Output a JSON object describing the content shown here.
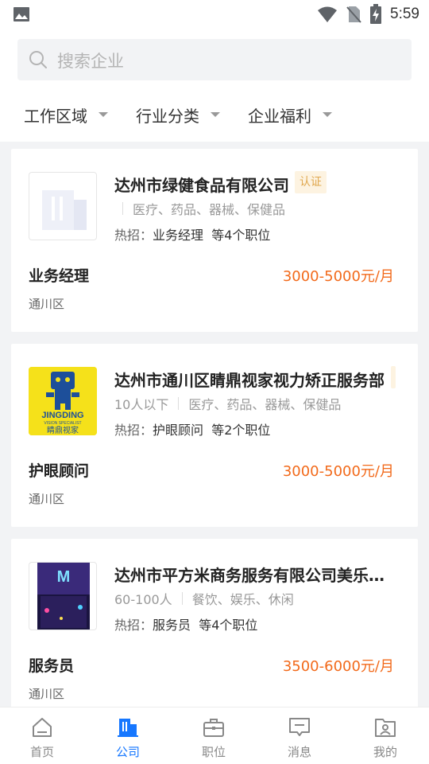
{
  "status_bar": {
    "time": "5:59"
  },
  "search": {
    "placeholder": "搜索企业"
  },
  "filters": [
    "工作区域",
    "行业分类",
    "企业福利"
  ],
  "companies": [
    {
      "name": "达州市绿健食品有限公司",
      "badge": "认证",
      "size": "",
      "industry": "医疗、药品、器械、保健品",
      "hot_label": "热招：",
      "hot_position": "业务经理",
      "hot_more": "等4个职位",
      "job_title": "业务经理",
      "salary": "3000-5000元/月",
      "district": "通川区"
    },
    {
      "name": "达州市通川区睛鼎视家视力矫正服务部",
      "badge": "",
      "size": "10人以下",
      "industry": "医疗、药品、器械、保健品",
      "hot_label": "热招：",
      "hot_position": "护眼顾问",
      "hot_more": "等2个职位",
      "job_title": "护眼顾问",
      "salary": "3000-5000元/月",
      "district": "通川区",
      "logo_text": "JINGDING",
      "logo_subtext": "VISION SPECIALIST",
      "logo_cn": "睛鼎视家"
    },
    {
      "name": "达州市平方米商务服务有限公司美乐…",
      "badge": "",
      "size": "60-100人",
      "industry": "餐饮、娱乐、休闲",
      "hot_label": "热招：",
      "hot_position": "服务员",
      "hot_more": "等4个职位",
      "job_title": "服务员",
      "salary": "3500-6000元/月",
      "district": "通川区"
    }
  ],
  "tabs": [
    {
      "label": "首页",
      "icon": "home-icon",
      "active": false
    },
    {
      "label": "公司",
      "icon": "company-icon",
      "active": true
    },
    {
      "label": "职位",
      "icon": "briefcase-icon",
      "active": false
    },
    {
      "label": "消息",
      "icon": "message-icon",
      "active": false
    },
    {
      "label": "我的",
      "icon": "profile-icon",
      "active": false
    }
  ],
  "colors": {
    "accent": "#1677ff",
    "salary": "#f26a1b",
    "badge_bg": "#fdf3e1",
    "badge_text": "#e0a84f",
    "logo_yellow": "#f5e11a"
  }
}
